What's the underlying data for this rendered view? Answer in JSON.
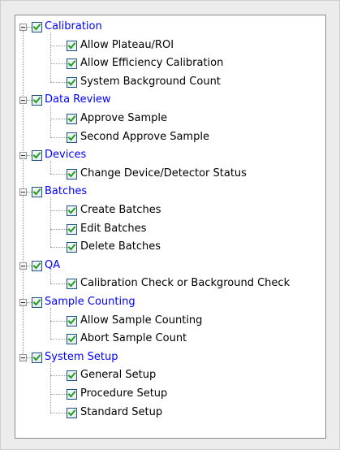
{
  "tree": {
    "groups": [
      {
        "label": "Calibration",
        "checked": true,
        "children": [
          {
            "label": "Allow Plateau/ROI",
            "checked": true
          },
          {
            "label": "Allow Efficiency Calibration",
            "checked": true
          },
          {
            "label": "System Background Count",
            "checked": true
          }
        ]
      },
      {
        "label": "Data Review",
        "checked": true,
        "children": [
          {
            "label": "Approve Sample",
            "checked": true
          },
          {
            "label": "Second Approve Sample",
            "checked": true
          }
        ]
      },
      {
        "label": "Devices",
        "checked": true,
        "children": [
          {
            "label": "Change Device/Detector Status",
            "checked": true
          }
        ]
      },
      {
        "label": "Batches",
        "checked": true,
        "children": [
          {
            "label": "Create Batches",
            "checked": true
          },
          {
            "label": "Edit Batches",
            "checked": true
          },
          {
            "label": "Delete Batches",
            "checked": true
          }
        ]
      },
      {
        "label": "QA",
        "checked": true,
        "children": [
          {
            "label": "Calibration Check or Background Check",
            "checked": true
          }
        ]
      },
      {
        "label": "Sample Counting",
        "checked": true,
        "children": [
          {
            "label": "Allow Sample Counting",
            "checked": true
          },
          {
            "label": "Abort Sample Count",
            "checked": true
          }
        ]
      },
      {
        "label": "System Setup",
        "checked": true,
        "children": [
          {
            "label": "General Setup",
            "checked": true
          },
          {
            "label": "Procedure Setup",
            "checked": true
          },
          {
            "label": "Standard Setup",
            "checked": true
          }
        ]
      }
    ]
  },
  "colors": {
    "parent_label": "#0000ff",
    "child_label": "#000000",
    "checkmark": "#1f9e1f"
  },
  "icons": {
    "expander": "minus-collapse-icon",
    "checkbox": "checkmark-icon"
  }
}
